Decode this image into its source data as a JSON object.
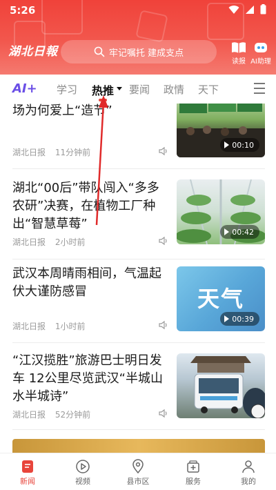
{
  "status_bar": {
    "time": "5:26"
  },
  "header": {
    "logo_text": "湖北日報",
    "search_placeholder": "牢记嘱托 建成支点",
    "read_label": "读报",
    "ai_label": "AI助理"
  },
  "tabs": {
    "ai_badge": "AI+",
    "items": [
      "学习",
      "热推",
      "要闻",
      "政情",
      "天下"
    ],
    "active": "热推"
  },
  "feed": [
    {
      "title_line1": "",
      "title_line2": "场为何爱上“造节”",
      "source": "湖北日报",
      "time": "11分钟前",
      "duration": "00:10"
    },
    {
      "title_line1": "湖北“00后”带队闯入“多多",
      "title_line2": "农研”决赛，在植物工厂种",
      "title_line3": "出“智慧草莓”",
      "source": "湖北日报",
      "time": "2小时前",
      "duration": "00:42"
    },
    {
      "title_line1": "武汉本周晴雨相间，气温起",
      "title_line2": "伏大谨防感冒",
      "source": "湖北日报",
      "time": "1小时前",
      "duration": "00:39",
      "thumb_text": "天气"
    },
    {
      "title_line1": "“江汉揽胜”旅游巴士明日发",
      "title_line2": "车 12公里尽览武汉“半城山",
      "title_line3": "水半城诗”",
      "source": "湖北日报",
      "time": "52分钟前"
    }
  ],
  "bottom_nav": [
    {
      "label": "新闻",
      "icon": "news-icon"
    },
    {
      "label": "视频",
      "icon": "video-play-icon"
    },
    {
      "label": "县市区",
      "icon": "location-pin-icon"
    },
    {
      "label": "服务",
      "icon": "service-box-icon"
    },
    {
      "label": "我的",
      "icon": "user-icon"
    }
  ],
  "colors": {
    "brand_red": "#e8453c",
    "ai_purple": "#6b4fe6"
  }
}
